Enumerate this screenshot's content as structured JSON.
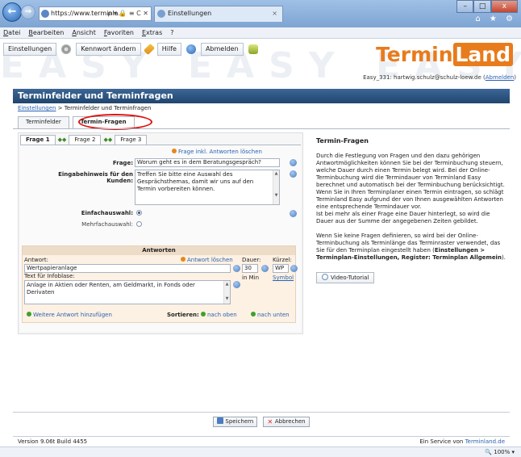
{
  "browser": {
    "url": "https://www.terminla...",
    "url_controls": "ρ ▾ 🔒 ≡ C ✕",
    "tab_title": "Einstellungen",
    "tab_close": "×",
    "back": "←",
    "forward": "→",
    "win_min": "–",
    "win_max": "□",
    "win_close": "x",
    "nav_icons": "⌂ ★ ⚙"
  },
  "menu": [
    "Datei",
    "Bearbeiten",
    "Ansicht",
    "Favoriten",
    "Extras",
    "?"
  ],
  "toolbar": {
    "settings": "Einstellungen",
    "change_password": "Kennwort ändern",
    "help": "Hilfe",
    "logout": "Abmelden"
  },
  "header": {
    "watermark": "EASY EASY EASY EASY",
    "logo_a": "Termin",
    "logo_b": "Land",
    "user_line": "Easy_331: hartwig.schulz@schulz-loew.de (",
    "logout_link": "Abmelden",
    "user_line_end": ")"
  },
  "page": {
    "title": "Terminfelder und Terminfragen",
    "breadcrumb_link": "Einstellungen",
    "breadcrumb_rest": " > Terminfelder und Terminfragen"
  },
  "main_tabs": [
    "Terminfelder",
    "Termin-Fragen"
  ],
  "frage_tabs": [
    "Frage 1",
    "Frage 2",
    "Frage 3"
  ],
  "arrows": "◆◆",
  "form": {
    "delete_question": "Frage inkl. Antworten löschen",
    "question_label": "Frage:",
    "question_value": "Worum geht es in dem Beratungsgespräch?",
    "hint_label_1": "Eingabehinweis für den",
    "hint_label_2": "Kunden:",
    "hint_value": "Treffen Sie bitte eine Auswahl des Gesprächsthemas, damit wir uns auf den Termin vorbereiten können.",
    "single_choice": "Einfachauswahl:",
    "multi_choice": "Mehrfachauswahl:"
  },
  "answers": {
    "heading": "Antworten",
    "answer_label": "Antwort:",
    "delete_answer": "Antwort löschen",
    "duration_label": "Dauer:",
    "short_label": "Kürzel:",
    "answer_value": "Wertpapieranlage",
    "duration_value": "30",
    "short_value": "WP",
    "duration_unit": "in Min",
    "symbol_link": "Symbol",
    "infobox_label": "Text für Infoblase:",
    "infobox_value": "Anlage in Aktien oder Renten, am Geldmarkt, in Fonds oder Derivaten",
    "add_answer": "Weitere Antwort hinzufügen",
    "sort_label": "Sortieren:",
    "sort_up": "nach oben",
    "sort_down": "nach unten"
  },
  "help": {
    "title": "Termin-Fragen",
    "p1": "Durch die Festlegung von Fragen und den dazu gehörigen Antwortmöglichkeiten können Sie bei der Terminbuchung steuern, welche Dauer durch einen Termin belegt wird. Bei der Online-Terminbuchung wird die Termindauer von Terminland Easy berechnet und automatisch bei der Terminbuchung berücksichtigt. Wenn Sie in Ihren Terminplaner einen Termin eintragen, so schlägt Terminland Easy aufgrund der von Ihnen ausgewählten Antworten eine entsprechende Termindauer vor.",
    "p1b": "Ist bei mehr als einer Frage eine Dauer hinterlegt, so wird die Dauer aus der Summe der angegebenen Zeiten gebildet.",
    "p2": "Wenn Sie keine Fragen definieren, so wird bei der Online-Terminbuchung als Terminlänge das Terminraster verwendet, das Sie für den Terminplan eingestellt haben (",
    "p2_bold": "Einstellungen > Terminplan-Einstellungen, Register: Terminplan Allgemein",
    "p2_end": ").",
    "video": "Video-Tutorial"
  },
  "actions": {
    "save": "Speichern",
    "cancel": "Abbrechen"
  },
  "footer": {
    "version": "Version 9.06t Build 4455",
    "service": "Ein Service von ",
    "service_link": "Terminland.de"
  },
  "status": {
    "zoom": "🔍 100%  ▾"
  }
}
